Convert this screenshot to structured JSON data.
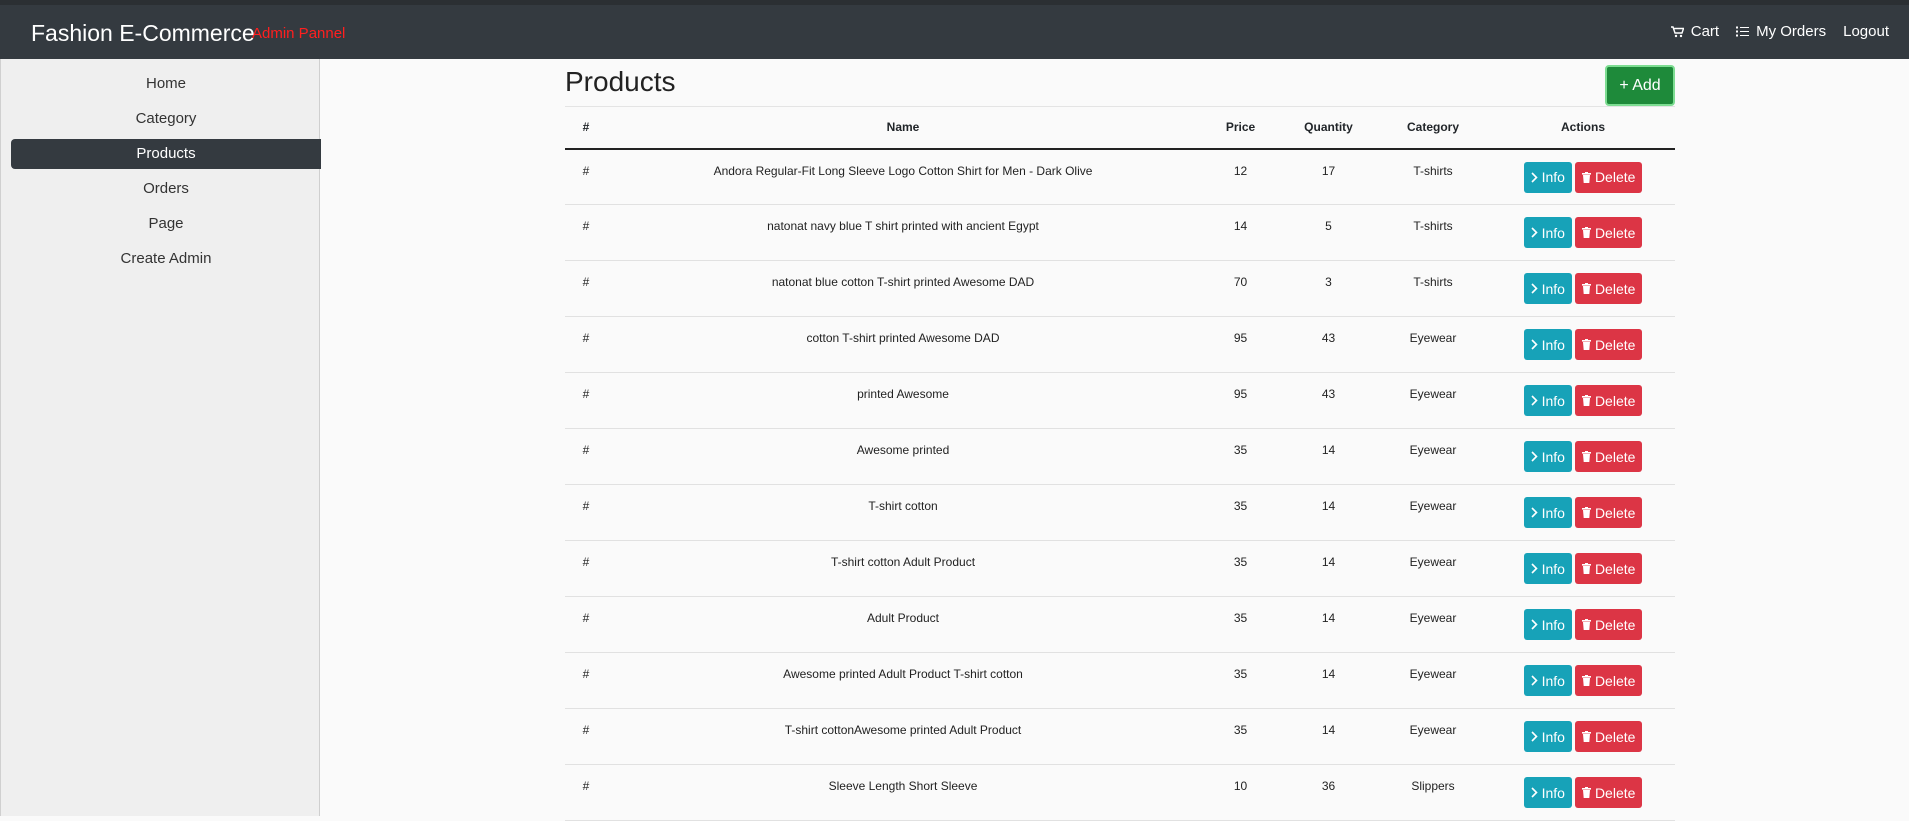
{
  "header": {
    "brand": "Fashion E-Commerce",
    "subtitle": "Admin Pannel",
    "links": [
      {
        "label": "Cart",
        "icon": "cart-icon"
      },
      {
        "label": "My Orders",
        "icon": "list-icon"
      },
      {
        "label": "Logout"
      }
    ]
  },
  "sidebar": {
    "items": [
      {
        "label": "Home"
      },
      {
        "label": "Category"
      },
      {
        "label": "Products",
        "active": true
      },
      {
        "label": "Orders"
      },
      {
        "label": "Page"
      },
      {
        "label": "Create Admin"
      }
    ]
  },
  "main": {
    "title": "Products",
    "add_label": "+ Add",
    "columns": [
      "#",
      "Name",
      "Price",
      "Quantity",
      "Category",
      "Actions"
    ],
    "info_label": "Info",
    "delete_label": "Delete",
    "rows": [
      {
        "num": "#",
        "name": "Andora Regular-Fit Long Sleeve Logo Cotton Shirt for Men - Dark Olive",
        "price": "12",
        "qty": "17",
        "category": "T-shirts"
      },
      {
        "num": "#",
        "name": "natonat navy blue T shirt printed with ancient Egypt",
        "price": "14",
        "qty": "5",
        "category": "T-shirts"
      },
      {
        "num": "#",
        "name": "natonat blue cotton T-shirt printed Awesome DAD",
        "price": "70",
        "qty": "3",
        "category": "T-shirts"
      },
      {
        "num": "#",
        "name": "cotton T-shirt printed Awesome DAD",
        "price": "95",
        "qty": "43",
        "category": "Eyewear"
      },
      {
        "num": "#",
        "name": "printed Awesome",
        "price": "95",
        "qty": "43",
        "category": "Eyewear"
      },
      {
        "num": "#",
        "name": "Awesome printed",
        "price": "35",
        "qty": "14",
        "category": "Eyewear"
      },
      {
        "num": "#",
        "name": "T-shirt cotton",
        "price": "35",
        "qty": "14",
        "category": "Eyewear"
      },
      {
        "num": "#",
        "name": "T-shirt cotton Adult Product",
        "price": "35",
        "qty": "14",
        "category": "Eyewear"
      },
      {
        "num": "#",
        "name": "Adult Product",
        "price": "35",
        "qty": "14",
        "category": "Eyewear"
      },
      {
        "num": "#",
        "name": "Awesome printed Adult Product T-shirt cotton",
        "price": "35",
        "qty": "14",
        "category": "Eyewear"
      },
      {
        "num": "#",
        "name": "T-shirt cottonAwesome printed Adult Product",
        "price": "35",
        "qty": "14",
        "category": "Eyewear"
      },
      {
        "num": "#",
        "name": "Sleeve Length Short Sleeve",
        "price": "10",
        "qty": "36",
        "category": "Slippers"
      }
    ]
  },
  "colors": {
    "navbar": "#343a40",
    "subtitle": "#ff1f1f",
    "add_button": "#1e8a3a",
    "info_button": "#17a2b8",
    "delete_button": "#dc3545"
  }
}
